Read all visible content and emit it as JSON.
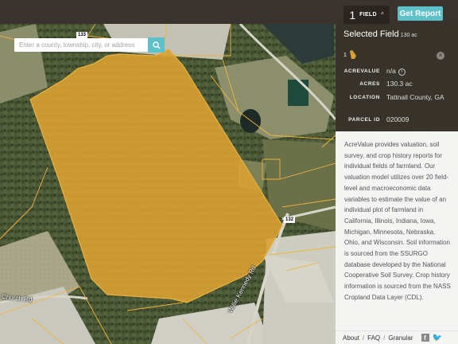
{
  "topbar": {
    "field_count": "1",
    "field_label": "FIELD",
    "get_report_label": "Get Report"
  },
  "search": {
    "placeholder": "Enter a county, township, city, or address"
  },
  "map": {
    "route_shields": [
      "133",
      "132"
    ],
    "road_labels": [
      "Church Rd",
      "Willie Kennedy Rd"
    ],
    "field_color": "#d9a133"
  },
  "panel": {
    "title": "Selected Field",
    "title_sub": "130 ac",
    "field_index": "1",
    "attributes": [
      {
        "key": "ACREVALUE",
        "value": "n/a",
        "info": "i"
      },
      {
        "key": "ACRES",
        "value": "130.3 ac"
      },
      {
        "key": "LOCATION",
        "value": "Tattnall County, GA"
      },
      {
        "key": "PARCEL ID",
        "value": "020009"
      }
    ],
    "description": "AcreValue provides valuation, soil survey, and crop history reports for individual fields of farmland. Our valuation model utilizes over 20 field-level and macroeconomic data variables to estimate the value of an individual plot of farmland in California, Illinois, Indiana, Iowa, Michigan, Minnesota, Nebraska, Ohio, and Wisconsin. Soil information is sourced from the SSURGO database developed by the National Cooperative Soil Survey. Crop history information is sourced from the NASS Cropland Data Layer (CDL).",
    "footer": {
      "about": "About",
      "faq": "FAQ",
      "granular": "Granular",
      "separator": "/",
      "facebook_icon": "f",
      "twitter_icon": "🐦"
    }
  },
  "colors": {
    "accent": "#5ec1c9",
    "topbar": "#3a332d",
    "field": "#d9a133"
  }
}
